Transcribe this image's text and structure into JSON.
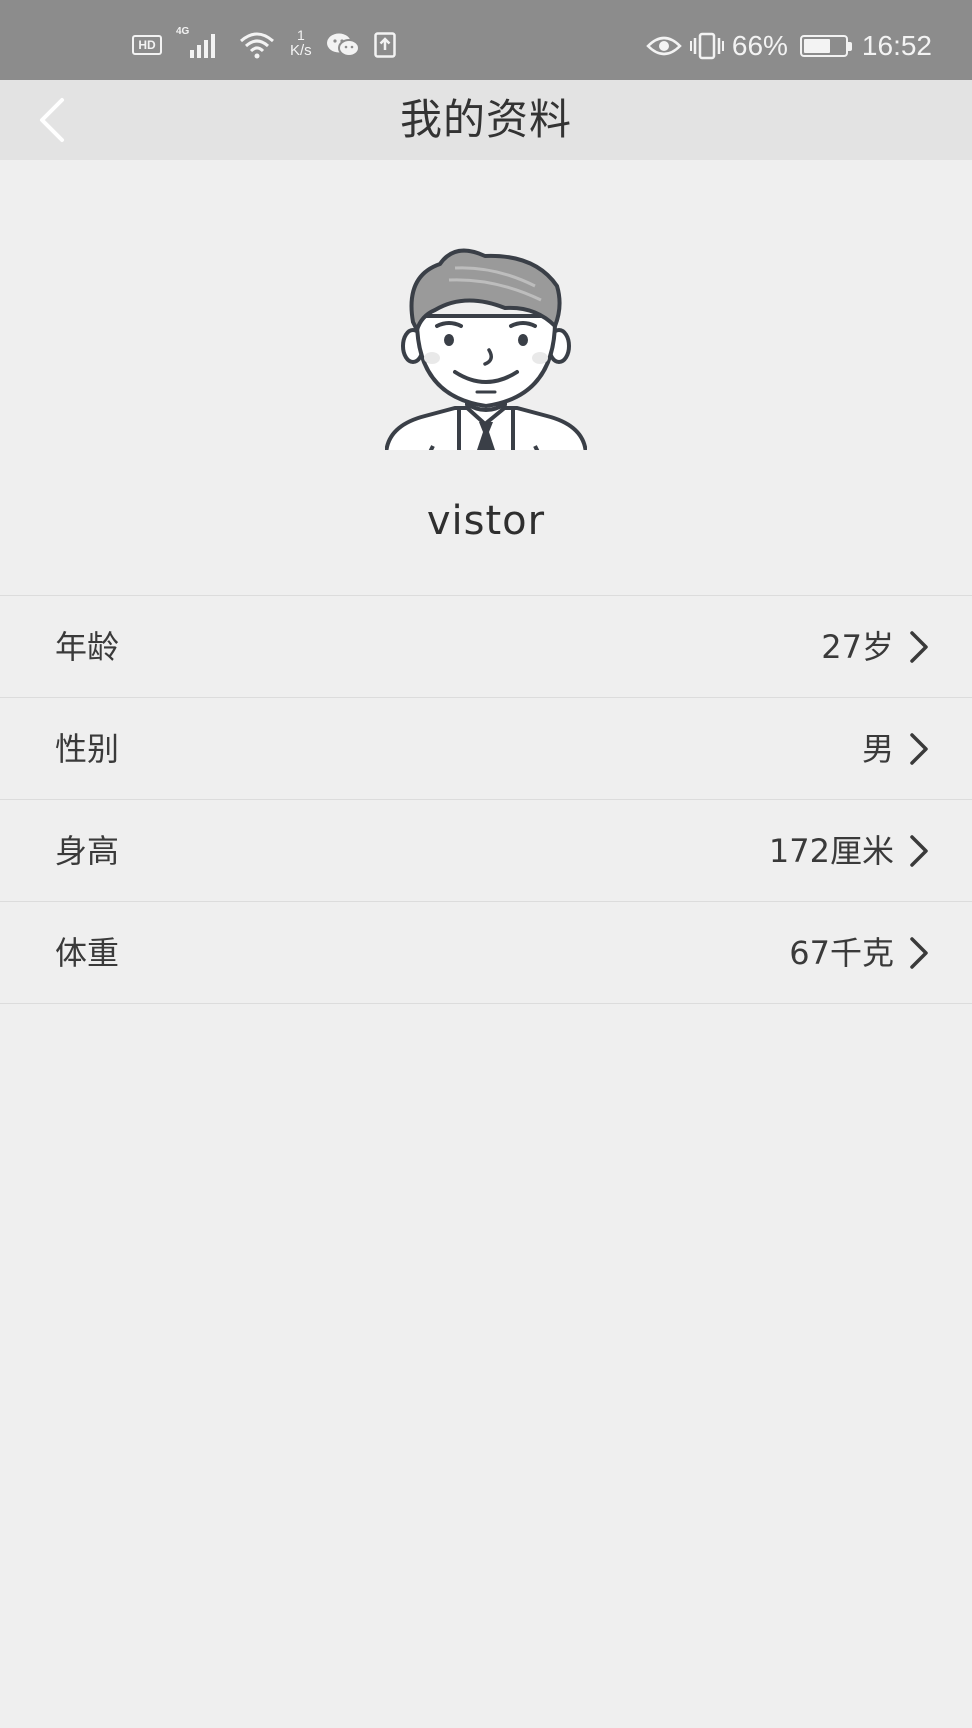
{
  "status_bar": {
    "hd_label": "HD",
    "network_type": "4G",
    "speed_value": "1",
    "speed_unit": "K/s",
    "battery_percent": "66%",
    "battery_level": 0.66,
    "time": "16:52",
    "icons": [
      "hd-icon",
      "signal-icon",
      "wifi-icon",
      "wechat-icon",
      "upload-icon",
      "eye-icon",
      "vibrate-icon",
      "battery-icon"
    ]
  },
  "header": {
    "title": "我的资料",
    "back_icon": "chevron-left-icon"
  },
  "profile": {
    "avatar_icon": "avatar-man-icon",
    "username": "vistor"
  },
  "info_rows": [
    {
      "label": "年龄",
      "value": "27岁"
    },
    {
      "label": "性别",
      "value": "男"
    },
    {
      "label": "身高",
      "value": "172厘米"
    },
    {
      "label": "体重",
      "value": "67千克"
    }
  ],
  "colors": {
    "status_bar_bg": "#8c8c8c",
    "nav_bar_bg": "#e3e3e3",
    "page_bg": "#efefef",
    "text": "#3a3a3a",
    "divider": "#dcdcdc"
  }
}
